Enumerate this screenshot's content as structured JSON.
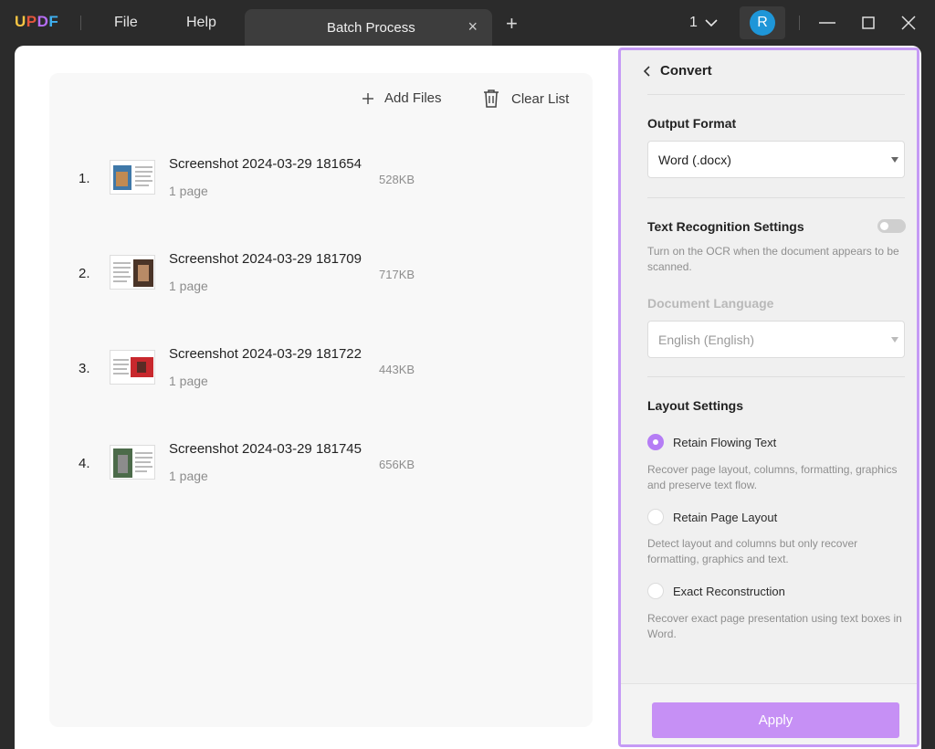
{
  "app": {
    "logo": [
      "U",
      "P",
      "D",
      "F"
    ],
    "logo_colors": [
      "#f6c443",
      "#e2553c",
      "#b66ef5",
      "#3fb0f0"
    ],
    "menu": {
      "file": "File",
      "help": "Help"
    },
    "tab": {
      "label": "Batch Process",
      "close": "×",
      "add": "+"
    },
    "page_count": "1",
    "avatar_letter": "R",
    "accent": "#b57df5"
  },
  "list": {
    "add_files": "Add Files",
    "clear_list": "Clear List",
    "files": [
      {
        "num": "1.",
        "name": "Screenshot 2024-03-29 181654",
        "pages": "1 page",
        "size": "528KB"
      },
      {
        "num": "2.",
        "name": "Screenshot 2024-03-29 181709",
        "pages": "1 page",
        "size": "717KB"
      },
      {
        "num": "3.",
        "name": "Screenshot 2024-03-29 181722",
        "pages": "1 page",
        "size": "443KB"
      },
      {
        "num": "4.",
        "name": "Screenshot 2024-03-29 181745",
        "pages": "1 page",
        "size": "656KB"
      }
    ]
  },
  "panel": {
    "back_title": "Convert",
    "output_format_label": "Output Format",
    "output_format_value": "Word (.docx)",
    "ocr_label": "Text Recognition Settings",
    "ocr_enabled": false,
    "ocr_desc": "Turn on the OCR when the document appears to be scanned.",
    "doc_lang_label": "Document Language",
    "doc_lang_value": "English (English)",
    "layout_label": "Layout Settings",
    "options": [
      {
        "label": "Retain Flowing Text",
        "desc": "Recover page layout, columns, formatting, graphics and preserve text flow.",
        "selected": true
      },
      {
        "label": "Retain Page Layout",
        "desc": "Detect layout and columns but only recover formatting, graphics and text.",
        "selected": false
      },
      {
        "label": "Exact Reconstruction",
        "desc": "Recover exact page presentation using text boxes in Word.",
        "selected": false
      }
    ],
    "apply": "Apply"
  }
}
